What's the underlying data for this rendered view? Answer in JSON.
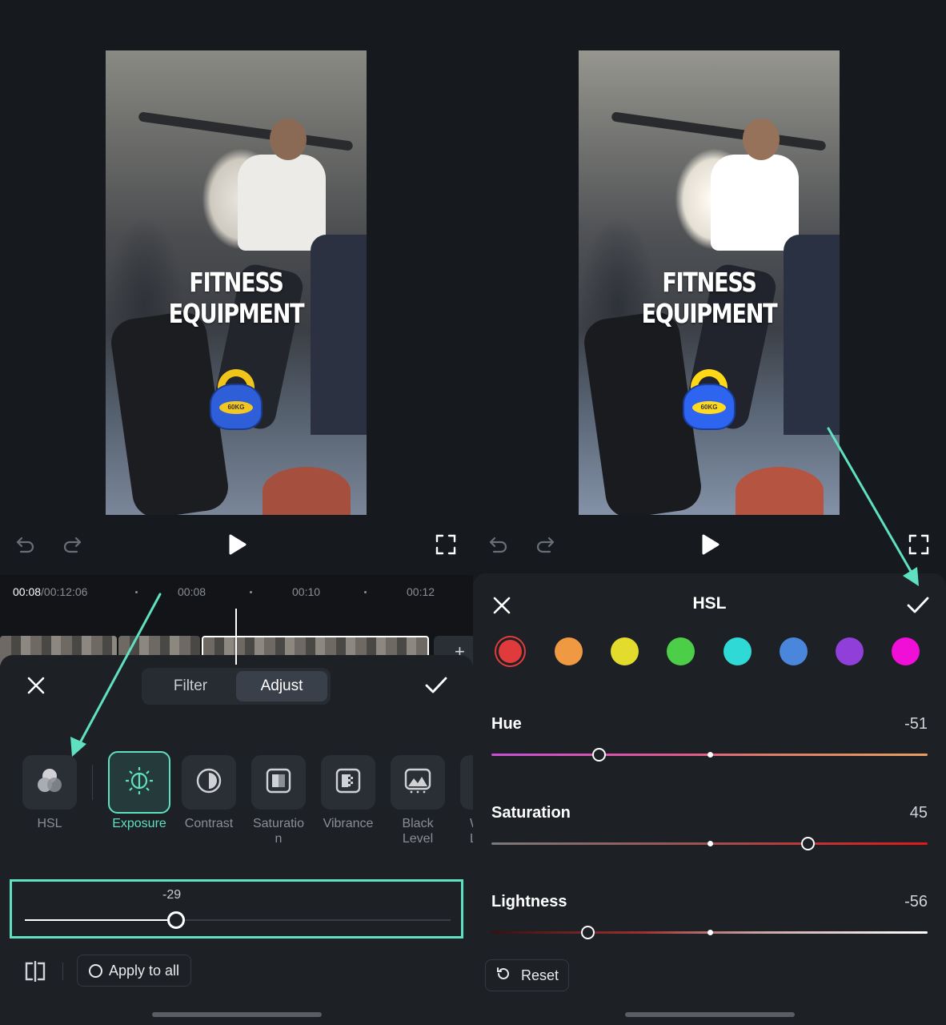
{
  "colors": {
    "accent": "#5fe1c1",
    "background": "#161a1f",
    "panel": "#1d2126"
  },
  "left": {
    "video": {
      "title_overlay": "FITNESS EQUIPMENT",
      "sticker_text": "60KG"
    },
    "timeline": {
      "current_time": "00:08",
      "total_time": "/00:12",
      "total_suffix": ":06",
      "ticks": [
        "00:08",
        "00:10",
        "00:12"
      ]
    },
    "tabs": [
      {
        "label": "Filter"
      },
      {
        "label": "Adjust"
      }
    ],
    "tools": [
      {
        "label": "HSL",
        "icon": "hsl-icon"
      },
      {
        "label": "Exposure",
        "icon": "exposure-icon",
        "active": true
      },
      {
        "label": "Contrast",
        "icon": "contrast-icon"
      },
      {
        "label": "Saturatio\nn",
        "icon": "saturation-icon"
      },
      {
        "label": "Vibrance",
        "icon": "vibrance-icon"
      },
      {
        "label": "Black\nLevel",
        "icon": "black-level-icon"
      },
      {
        "label": "W\nL",
        "icon": "white-level-icon"
      }
    ],
    "exposure": {
      "value": "-29",
      "level": -29,
      "min": -100,
      "max": 100
    },
    "apply_to_all_label": "Apply to all"
  },
  "right": {
    "title": "HSL",
    "swatches": [
      {
        "name": "red",
        "color": "#e03a3c",
        "selected": true
      },
      {
        "name": "orange",
        "color": "#ef9a42"
      },
      {
        "name": "yellow",
        "color": "#e3dc2c"
      },
      {
        "name": "green",
        "color": "#4cce48"
      },
      {
        "name": "cyan",
        "color": "#2fd9d6"
      },
      {
        "name": "blue",
        "color": "#4a86dc"
      },
      {
        "name": "purple",
        "color": "#9040d8"
      },
      {
        "name": "magenta",
        "color": "#ef0fd7"
      }
    ],
    "hue": {
      "label": "Hue",
      "value": "-51",
      "level": -51
    },
    "saturation": {
      "label": "Saturation",
      "value": "45",
      "level": 45
    },
    "lightness": {
      "label": "Lightness",
      "value": "-56",
      "level": -56
    },
    "reset_label": "Reset"
  }
}
